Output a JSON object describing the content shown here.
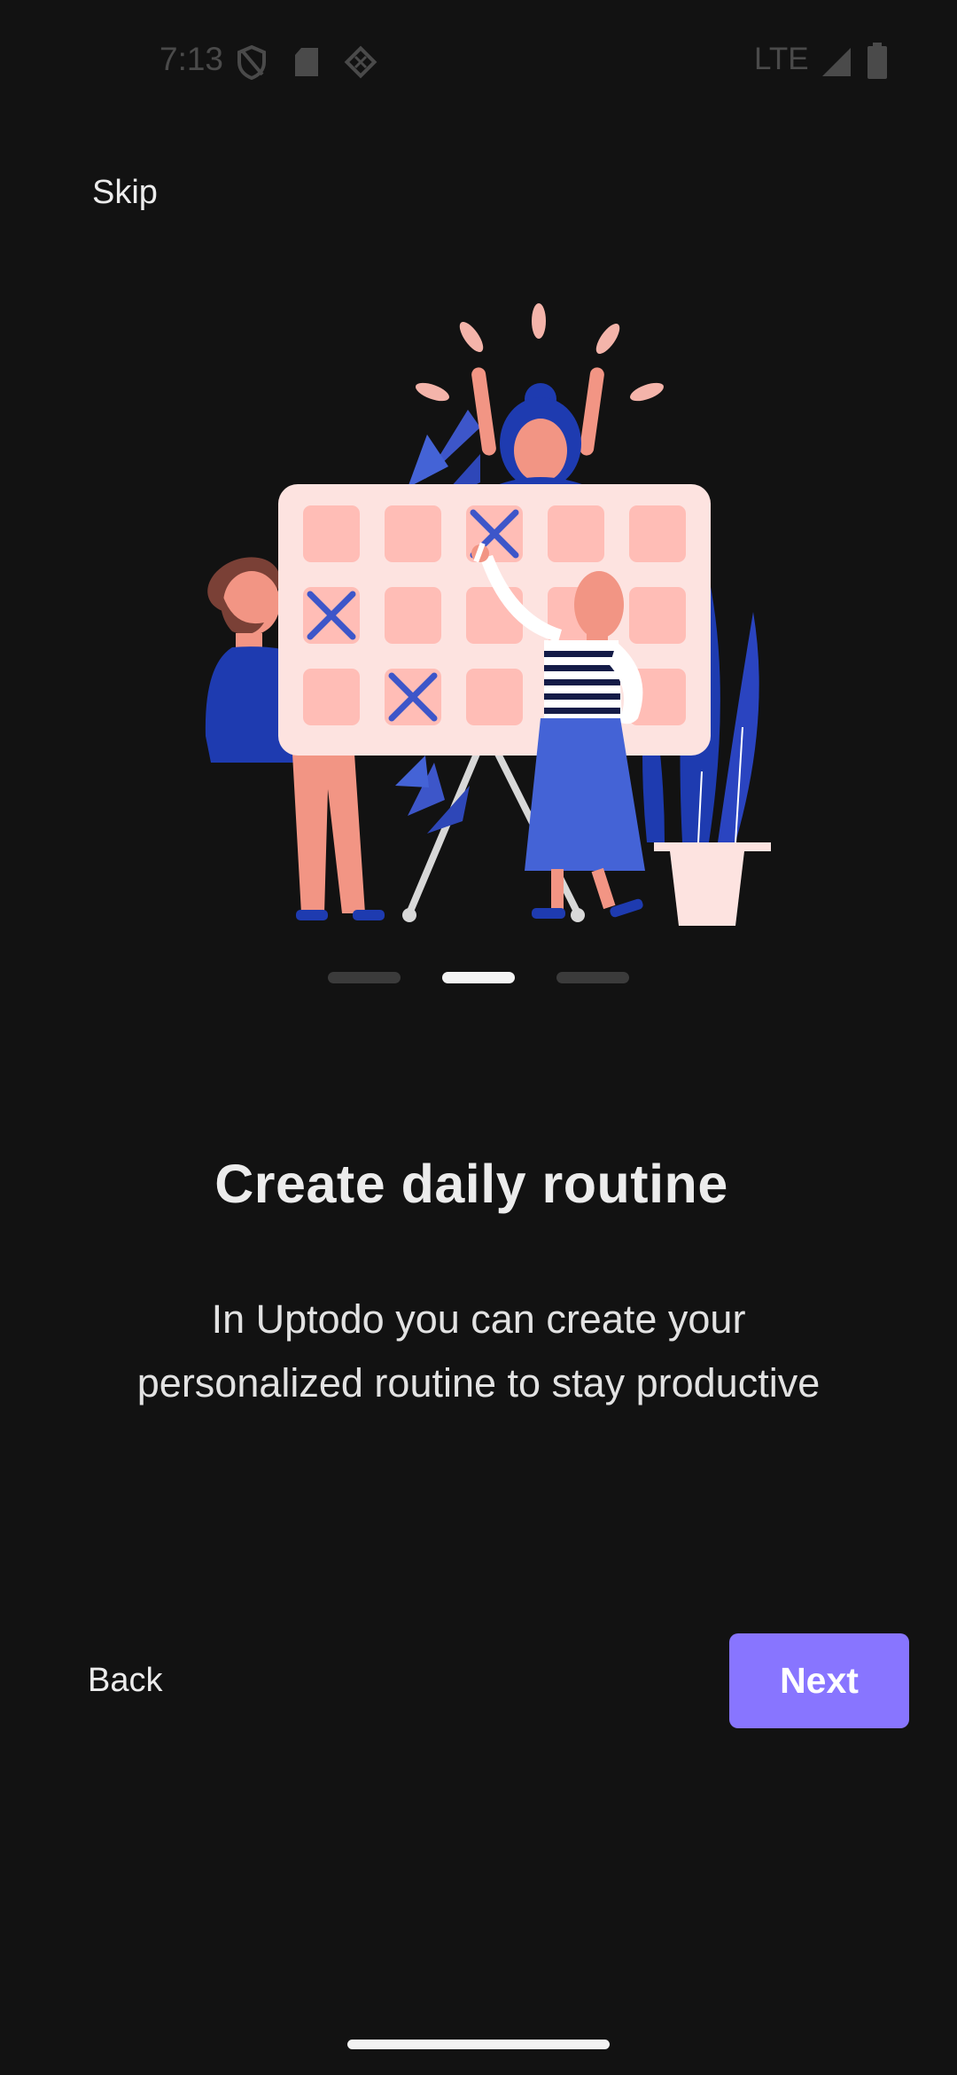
{
  "status_bar": {
    "time": "7:13",
    "network": "LTE",
    "icons": [
      "shield-icon",
      "sd-card-icon",
      "app-notification-icon",
      "signal-icon",
      "battery-icon"
    ]
  },
  "onboarding": {
    "skip_label": "Skip",
    "illustration": "people-planning-calendar-illustration",
    "pages_total": 3,
    "current_page": 2,
    "title": "Create daily routine",
    "description": "In Uptodo  you can create your\npersonalized routine to stay productive",
    "back_label": "Back",
    "next_label": "Next"
  },
  "colors": {
    "background": "#121212",
    "accent": "#8875ff",
    "indicator_active": "#f3f3f3",
    "indicator_inactive": "#3b3b3b"
  }
}
